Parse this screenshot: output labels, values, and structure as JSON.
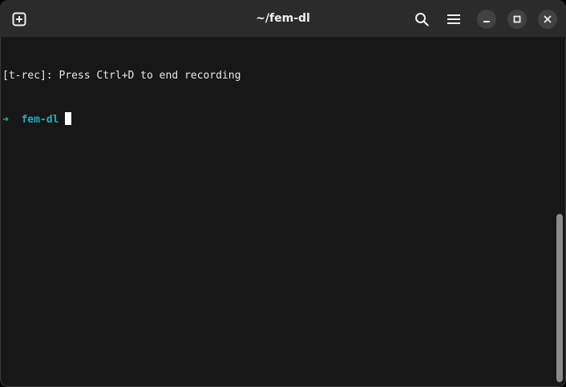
{
  "window": {
    "title": "~/fem-dl"
  },
  "header": {
    "new_tab_icon": "new-tab-plus-icon",
    "search_icon": "search-icon",
    "menu_icon": "hamburger-menu-icon",
    "minimize_icon": "minimize-icon",
    "maximize_icon": "maximize-icon",
    "close_icon": "close-icon"
  },
  "terminal": {
    "line1": "[t-rec]: Press Ctrl+D to end recording",
    "prompt_arrow": "➜",
    "prompt_dir": "fem-dl"
  },
  "colors": {
    "background": "#171717",
    "titlebar": "#2b2b2b",
    "prompt_arrow": "#2ab38a",
    "prompt_dir": "#29a8b8",
    "text": "#e8e8e8"
  },
  "scrollbar": {
    "thumb_position_fraction": 0.5
  }
}
